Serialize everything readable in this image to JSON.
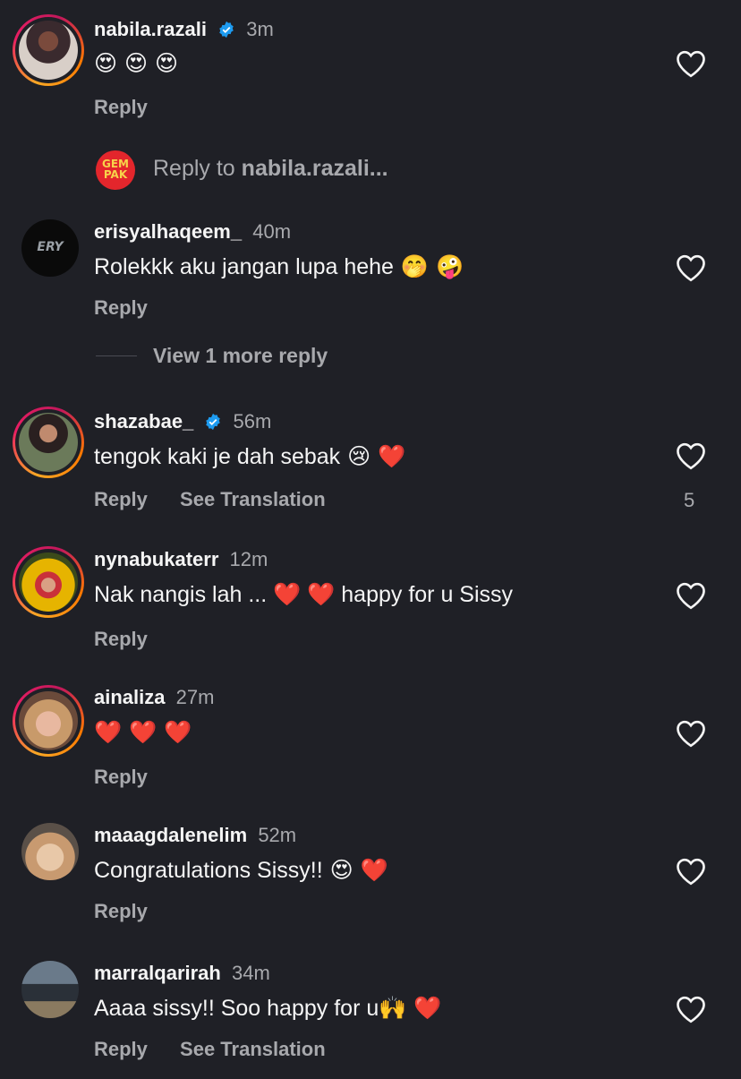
{
  "comments": [
    {
      "username": "nabila.razali",
      "time": "3m",
      "text": "",
      "emoji": "😍 😍 😍",
      "verified": true,
      "reply": "Reply",
      "translate": "",
      "likes": ""
    },
    {
      "username": "erisyalhaqeem_",
      "time": "40m",
      "text": "Rolekkk aku jangan lupa hehe",
      "emoji": " 🤭 🤪",
      "verified": false,
      "reply": "Reply",
      "translate": "",
      "likes": ""
    },
    {
      "username": "shazabae_",
      "time": "56m",
      "text": "tengok kaki je dah sebak",
      "emoji": " 😢 ❤️",
      "verified": true,
      "reply": "Reply",
      "translate": "See Translation",
      "likes": "5"
    },
    {
      "username": "nynabukaterr",
      "time": "12m",
      "text": "Nak nangis lah ... ❤️ ❤️ happy for u Sissy",
      "emoji": "",
      "verified": false,
      "reply": "Reply",
      "translate": "",
      "likes": ""
    },
    {
      "username": "ainaliza",
      "time": "27m",
      "text": "",
      "emoji": "❤️ ❤️ ❤️",
      "verified": false,
      "reply": "Reply",
      "translate": "",
      "likes": ""
    },
    {
      "username": "maaagdalenelim",
      "time": "52m",
      "text": "Congratulations Sissy!!",
      "emoji": " 😍 ❤️",
      "verified": false,
      "reply": "Reply",
      "translate": "",
      "likes": ""
    },
    {
      "username": "marralqarirah",
      "time": "34m",
      "text": "Aaaa sissy!! Soo happy for u",
      "emoji": "🙌 ❤️",
      "verified": false,
      "reply": "Reply",
      "translate": "See Translation",
      "likes": ""
    }
  ],
  "reply_to": {
    "prefix": "Reply to ",
    "target": "nabila.razali...",
    "avatar_label": "GEM PAK"
  },
  "view_more": "View 1 more reply",
  "avatar_labels": {
    "erisyalhaqeem_": "ERY"
  },
  "colors": {
    "background": "#1f2026",
    "secondary_text": "#a8a9ad",
    "verified_blue": "#1d9bf0"
  }
}
